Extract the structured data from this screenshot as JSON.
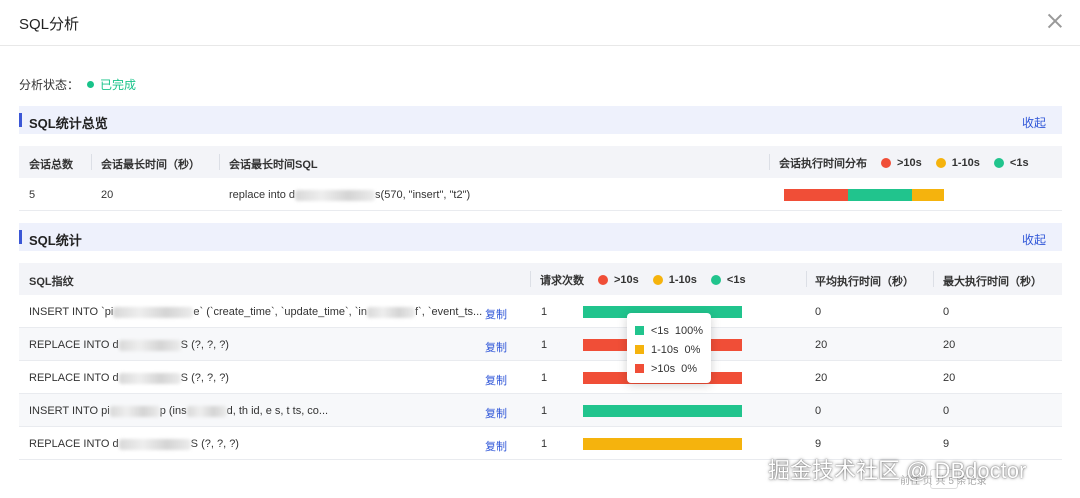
{
  "dialog": {
    "title": "SQL分析"
  },
  "status": {
    "label": "分析状态：",
    "value": "已完成",
    "color": "#19c38a"
  },
  "colors": {
    "red": "#f04e37",
    "green": "#21c48d",
    "yellow": "#f5b30d",
    "accent": "#3b57d6",
    "link": "#2f56d8"
  },
  "overview": {
    "title": "SQL统计总览",
    "collapse_label": "收起",
    "headers": {
      "sessions": "会话总数",
      "max_time": "会话最长时间（秒）",
      "max_sql": "会话最长时间SQL",
      "dist": "会话执行时间分布"
    },
    "legend": [
      {
        "label": ">10s",
        "color": "#f04e37"
      },
      {
        "label": "1-10s",
        "color": "#f5b30d"
      },
      {
        "label": "<1s",
        "color": "#21c48d"
      }
    ],
    "row": {
      "sessions": "5",
      "max_time": "20",
      "sql_prefix": "replace into d",
      "sql_suffix": "s(570, \"insert\", \"t2\")",
      "distribution": {
        "gt10": 0.4,
        "lt1": 0.4,
        "mid": 0.2
      }
    }
  },
  "stats": {
    "title": "SQL统计",
    "collapse_label": "收起",
    "headers": {
      "fingerprint": "SQL指纹",
      "requests": "请求次数",
      "avg": "平均执行时间（秒）",
      "max": "最大执行时间（秒）"
    },
    "legend": [
      {
        "label": ">10s",
        "color": "#f04e37"
      },
      {
        "label": "1-10s",
        "color": "#f5b30d"
      },
      {
        "label": "<1s",
        "color": "#21c48d"
      }
    ],
    "copy_label": "复制",
    "rows": [
      {
        "sql_a": "INSERT INTO `pi",
        "sql_b": "e` (`create_time`, `update_time`, `in",
        "sql_c": "f`, `event_ts...",
        "requests": "1",
        "avg": "0",
        "max": "0",
        "bar": "green"
      },
      {
        "sql_a": "REPLACE INTO d",
        "sql_b": "S (?, ?, ?)",
        "sql_c": "",
        "requests": "1",
        "avg": "20",
        "max": "20",
        "bar": "red"
      },
      {
        "sql_a": "REPLACE INTO d",
        "sql_b": "S (?, ?, ?)",
        "sql_c": "",
        "requests": "1",
        "avg": "20",
        "max": "20",
        "bar": "red"
      },
      {
        "sql_a": "INSERT INTO pi",
        "sql_b": "p (ins",
        "sql_c": "d, th    id, e    s, t    ts, co...",
        "requests": "1",
        "avg": "0",
        "max": "0",
        "bar": "green"
      },
      {
        "sql_a": "REPLACE INTO d",
        "sql_b": "S (?, ?, ?)",
        "sql_c": "",
        "requests": "1",
        "avg": "9",
        "max": "9",
        "bar": "yellow"
      }
    ]
  },
  "tooltip": [
    {
      "label": "<1s",
      "value": "100%",
      "color": "#21c48d"
    },
    {
      "label": "1-10s",
      "value": "0%",
      "color": "#f5b30d"
    },
    {
      "label": ">10s",
      "value": "0%",
      "color": "#f04e37"
    }
  ],
  "watermark": "掘金技术社区 @ DBdoctor",
  "pager": {
    "text": "前往      页 共 5 条记录"
  }
}
